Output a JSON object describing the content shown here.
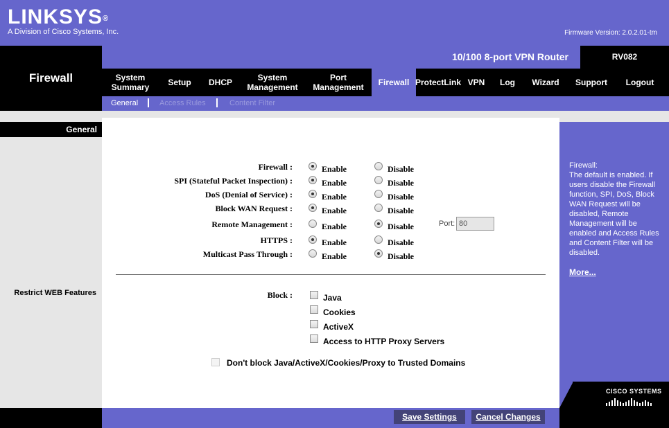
{
  "brand": {
    "logo": "LINKSYS",
    "logo_mark": "®",
    "tagline": "A Division of Cisco Systems, Inc.",
    "firmware": "Firmware Version: 2.0.2.01-tm"
  },
  "section_title": "Firewall",
  "product": {
    "name": "10/100 8-port VPN Router",
    "model": "RV082"
  },
  "nav": {
    "items": [
      {
        "label": "System Summary"
      },
      {
        "label": "Setup"
      },
      {
        "label": "DHCP"
      },
      {
        "label": "System Management"
      },
      {
        "label": "Port Management"
      },
      {
        "label": "Firewall"
      },
      {
        "label": "ProtectLink"
      },
      {
        "label": "VPN"
      },
      {
        "label": "Log"
      },
      {
        "label": "Wizard"
      },
      {
        "label": "Support"
      },
      {
        "label": "Logout"
      }
    ],
    "active": "Firewall"
  },
  "subnav": {
    "items": [
      {
        "label": "General",
        "active": true
      },
      {
        "label": "Access Rules",
        "active": false
      },
      {
        "label": "Content Filter",
        "active": false
      }
    ]
  },
  "left": {
    "general_label": "General",
    "restrict_label": "Restrict WEB Features"
  },
  "settings": {
    "enable_label": "Enable",
    "disable_label": "Disable",
    "rows": [
      {
        "label": "Firewall :",
        "value": "Enable"
      },
      {
        "label": "SPI (Stateful Packet Inspection) :",
        "value": "Enable"
      },
      {
        "label": "DoS (Denial of Service) :",
        "value": "Enable"
      },
      {
        "label": "Block WAN Request :",
        "value": "Enable"
      },
      {
        "label": "Remote Management :",
        "value": "Disable"
      },
      {
        "label": "HTTPS :",
        "value": "Enable"
      },
      {
        "label": "Multicast Pass Through :",
        "value": "Disable"
      }
    ],
    "port_label": "Port:",
    "port_value": "80"
  },
  "restrict": {
    "block_label": "Block :",
    "options": [
      {
        "label": "Java",
        "checked": false
      },
      {
        "label": "Cookies",
        "checked": false
      },
      {
        "label": "ActiveX",
        "checked": false
      },
      {
        "label": "Access to HTTP Proxy Servers",
        "checked": false
      }
    ],
    "trusted_label": "Don't block Java/ActiveX/Cookies/Proxy to Trusted Domains",
    "trusted_checked": false
  },
  "help": {
    "title": "Firewall:",
    "text": "The default is enabled. If users disable the Firewall function, SPI, DoS, Block WAN Request will be disabled, Remote Management will be enabled and Access Rules and Content Filter will be disabled.",
    "more": "More...",
    "cisco": "CISCO SYSTEMS"
  },
  "footer": {
    "save": "Save Settings",
    "cancel": "Cancel Changes"
  },
  "colors": {
    "accent": "#6666cc",
    "dark": "#000000",
    "panel_grey": "#e6e6e6",
    "button": "#434378"
  }
}
